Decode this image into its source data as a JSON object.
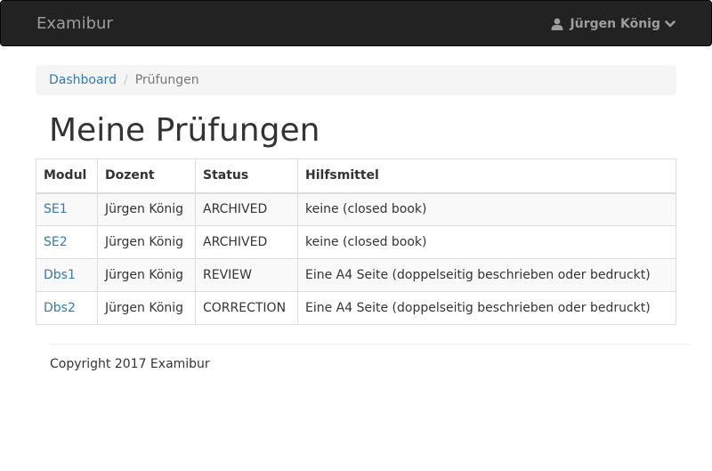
{
  "navbar": {
    "brand": "Examibur",
    "user_name": "Jürgen König",
    "user_icon": "user-icon",
    "dropdown_icon": "chevron-down-icon"
  },
  "breadcrumb": {
    "items": [
      "Dashboard",
      "Prüfungen"
    ]
  },
  "page": {
    "title": "Meine Prüfungen"
  },
  "table": {
    "headers": [
      "Modul",
      "Dozent",
      "Status",
      "Hilfsmittel"
    ],
    "rows": [
      {
        "modul": "SE1",
        "dozent": "Jürgen König",
        "status": "ARCHIVED",
        "hilfsmittel": "keine (closed book)"
      },
      {
        "modul": "SE2",
        "dozent": "Jürgen König",
        "status": "ARCHIVED",
        "hilfsmittel": "keine (closed book)"
      },
      {
        "modul": "Dbs1",
        "dozent": "Jürgen König",
        "status": "REVIEW",
        "hilfsmittel": "Eine A4 Seite (doppelseitig beschrieben oder bedruckt)"
      },
      {
        "modul": "Dbs2",
        "dozent": "Jürgen König",
        "status": "CORRECTION",
        "hilfsmittel": "Eine A4 Seite (doppelseitig beschrieben oder bedruckt)"
      }
    ]
  },
  "footer": {
    "copyright": "Copyright 2017 Examibur"
  },
  "colors": {
    "navbar_bg": "#222222",
    "navbar_text": "#9d9d9d",
    "link": "#337ab7",
    "breadcrumb_bg": "#f5f5f5"
  }
}
